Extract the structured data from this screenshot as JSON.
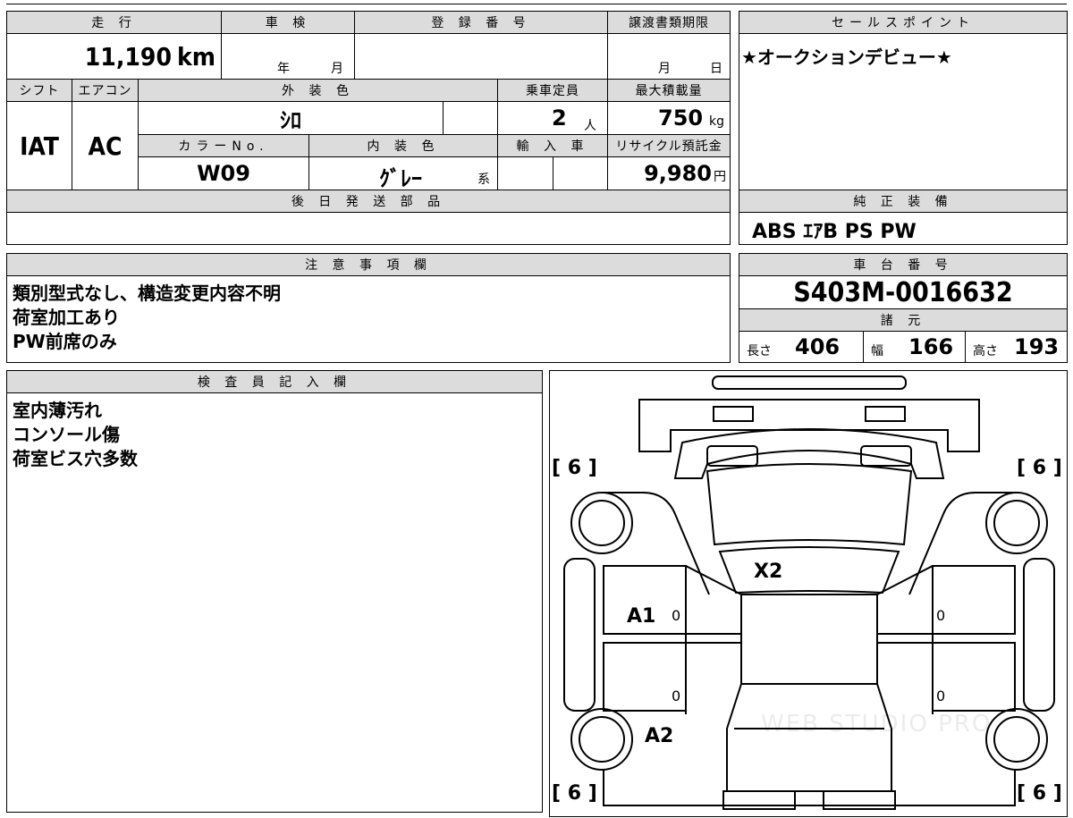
{
  "sheet": {
    "mileage": {
      "label": "走 行",
      "value": "11,190",
      "unit": "km"
    },
    "inspection": {
      "label": "車 検",
      "year_unit": "年",
      "month_unit": "月"
    },
    "registration": {
      "label": "登 録 番 号",
      "value": ""
    },
    "transfer_deadline": {
      "label": "譲渡書類期限",
      "month_unit": "月",
      "day_unit": "日"
    },
    "sales_point": {
      "label": "セールスポイント",
      "text": "★オークションデビュー★"
    },
    "shift": {
      "label": "シフト",
      "value": "IAT"
    },
    "aircon": {
      "label": "エアコン",
      "value": "AC"
    },
    "exterior_color": {
      "label": "外 装 色",
      "value": "ｼﾛ"
    },
    "capacity": {
      "label": "乗車定員",
      "value": "2",
      "unit": "人"
    },
    "max_load": {
      "label": "最大積載量",
      "value": "750",
      "unit": "kg"
    },
    "color_no": {
      "label": "カラーNo.",
      "value": "W09"
    },
    "interior_color": {
      "label": "内 装 色",
      "value": "ｸﾞﾚｰ",
      "suffix": "系"
    },
    "import": {
      "label": "輸 入 車"
    },
    "recycle_fee": {
      "label": "リサイクル預託金",
      "value": "9,980",
      "unit": "円"
    },
    "later_parts": {
      "label": "後 日 発 送 部 品",
      "value": ""
    },
    "equipment": {
      "label": "純 正 装 備",
      "value": "ABS ｴｱB PS PW"
    },
    "notes": {
      "label": "注 意 事 項 欄",
      "lines": [
        "類別型式なし、構造変更内容不明",
        "荷室加工あり",
        "PW前席のみ"
      ]
    },
    "chassis": {
      "label": "車 台 番 号",
      "value": "S403M-0016632"
    },
    "specs": {
      "label": "諸 元",
      "length_label": "長さ",
      "length": "406",
      "width_label": "幅",
      "width": "166",
      "height_label": "高さ",
      "height": "193"
    },
    "inspector": {
      "label": "検 査 員 記 入 欄",
      "lines": [
        "室内薄汚れ",
        "コンソール傷",
        "荷室ビス穴多数"
      ]
    }
  },
  "diagram": {
    "tread": {
      "front_left": "6",
      "front_right": "6",
      "rear_left": "6",
      "rear_right": "6"
    },
    "marks": {
      "hood": "X2",
      "left_front_door": "A1",
      "left_rear": "A2"
    },
    "panel_zeros": [
      "0",
      "0",
      "0",
      "0"
    ],
    "watermark": "WEB STUDIO PRO"
  }
}
